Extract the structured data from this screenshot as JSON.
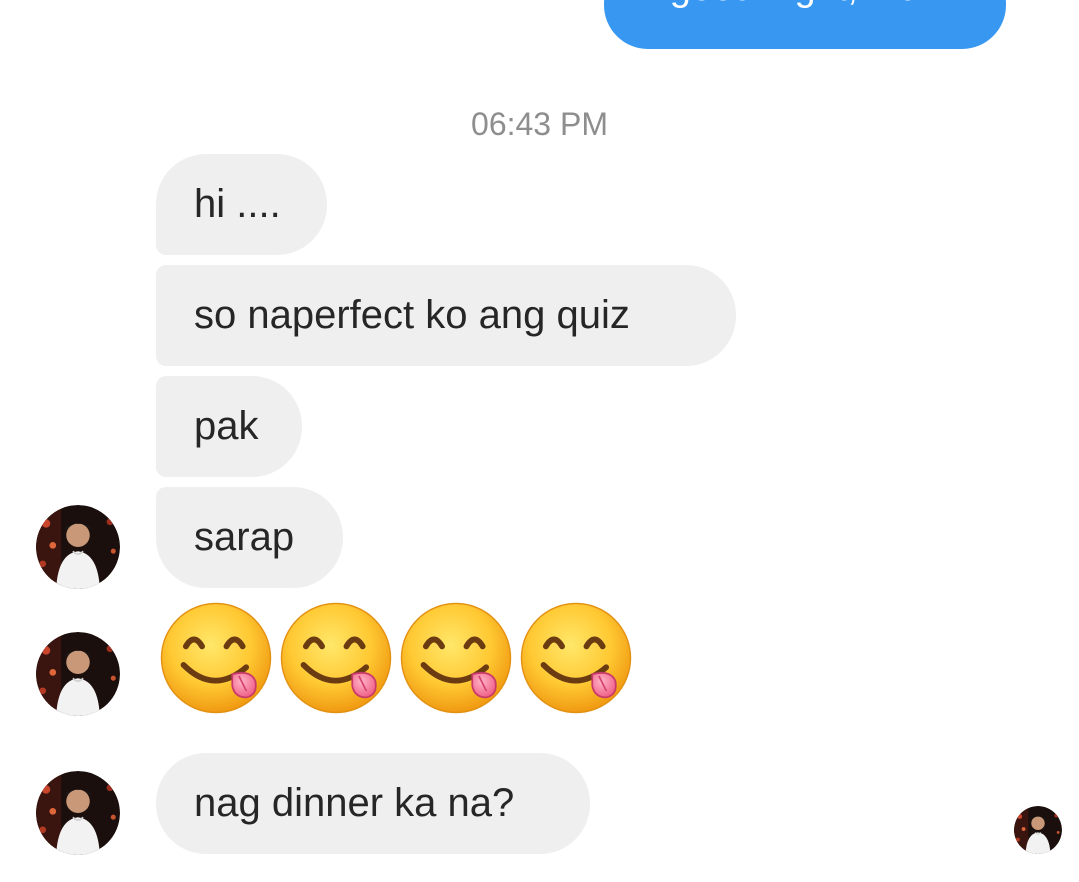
{
  "conversation": {
    "outgoing": [
      {
        "text": "good night, max"
      }
    ],
    "timestamp": "06:43 PM",
    "incoming": [
      {
        "text": "hi ...."
      },
      {
        "text": "so naperfect ko ang quiz"
      },
      {
        "text": "pak"
      },
      {
        "text": "sarap"
      },
      {
        "type": "emoji",
        "emoji": "face-savoring-food",
        "count": 4
      },
      {
        "text": "nag dinner ka na?"
      }
    ]
  },
  "icons": {
    "emoji": "face-savoring-food-icon",
    "avatar": "contact-avatar",
    "read_receipt": "seen-avatar"
  },
  "colors": {
    "outgoing_bubble": "#3897f0",
    "incoming_bubble": "#efefef",
    "timestamp_text": "#8e8e8e",
    "message_text": "#262626"
  }
}
